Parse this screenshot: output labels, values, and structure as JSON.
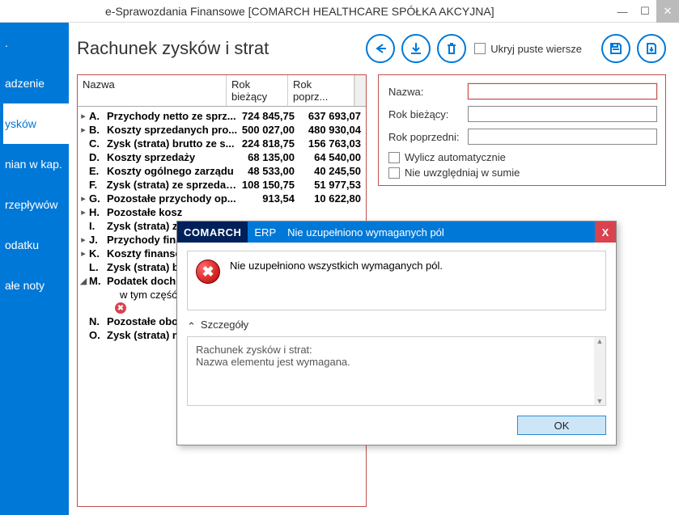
{
  "window": {
    "title": "e-Sprawozdania Finansowe  [COMARCH HEALTHCARE SPÓŁKA AKCYJNA]"
  },
  "sidebar": {
    "items": [
      {
        "label": "."
      },
      {
        "label": "adzenie"
      },
      {
        "label": "ysków"
      },
      {
        "label": "nian w kap."
      },
      {
        "label": "rzepływów"
      },
      {
        "label": "odatku"
      },
      {
        "label": "ałe noty"
      }
    ],
    "active_index": 2
  },
  "page": {
    "title": "Rachunek zysków i strat",
    "hide_empty_label": "Ukryj puste wiersze"
  },
  "table": {
    "headers": {
      "name": "Nazwa",
      "curr": "Rok bieżący",
      "prev": "Rok poprz..."
    },
    "rows": [
      {
        "exp": "▸",
        "let": "A.",
        "txt": "Przychody netto ze sprz...",
        "c1": "724 845,75",
        "c2": "637 693,07",
        "b": true
      },
      {
        "exp": "▸",
        "let": "B.",
        "txt": "Koszty sprzedanych pro...",
        "c1": "500 027,00",
        "c2": "480 930,04",
        "b": true
      },
      {
        "exp": "",
        "let": "C.",
        "txt": "Zysk (strata) brutto ze s...",
        "c1": "224 818,75",
        "c2": "156 763,03",
        "b": true
      },
      {
        "exp": "",
        "let": "D.",
        "txt": "Koszty sprzedaży",
        "c1": "68 135,00",
        "c2": "64 540,00",
        "b": true
      },
      {
        "exp": "",
        "let": "E.",
        "txt": "Koszty ogólnego zarządu",
        "c1": "48 533,00",
        "c2": "40 245,50",
        "b": true
      },
      {
        "exp": "",
        "let": "F.",
        "txt": "Zysk (strata) ze sprzedaż...",
        "c1": "108 150,75",
        "c2": "51 977,53",
        "b": true
      },
      {
        "exp": "▸",
        "let": "G.",
        "txt": "Pozostałe przychody op...",
        "c1": "913,54",
        "c2": "10 622,80",
        "b": true
      },
      {
        "exp": "▸",
        "let": "H.",
        "txt": "Pozostałe kosz",
        "c1": "",
        "c2": "",
        "b": true
      },
      {
        "exp": "",
        "let": "I.",
        "txt": "Zysk (strata) z",
        "c1": "",
        "c2": "",
        "b": true
      },
      {
        "exp": "▸",
        "let": "J.",
        "txt": "Przychody fina",
        "c1": "",
        "c2": "",
        "b": true
      },
      {
        "exp": "▸",
        "let": "K.",
        "txt": "Koszty finanso",
        "c1": "",
        "c2": "",
        "b": true
      },
      {
        "exp": "",
        "let": "L.",
        "txt": "Zysk (strata) b",
        "c1": "",
        "c2": "",
        "b": true
      },
      {
        "exp": "◢",
        "let": "M.",
        "txt": "Podatek doch",
        "c1": "",
        "c2": "",
        "b": true
      },
      {
        "exp": "",
        "let": "",
        "txt": "w tym część od",
        "c1": "",
        "c2": "",
        "b": false,
        "indent": true
      },
      {
        "exp": "",
        "let": "",
        "txt": "__ERROR__",
        "c1": "",
        "c2": "",
        "b": false,
        "indent": true
      },
      {
        "exp": "",
        "let": "N.",
        "txt": "Pozostałe obo",
        "c1": "",
        "c2": "",
        "b": true
      },
      {
        "exp": "",
        "let": "O.",
        "txt": "Zysk (strata) n",
        "c1": "",
        "c2": "",
        "b": true
      }
    ]
  },
  "form": {
    "name_label": "Nazwa:",
    "curr_label": "Rok bieżący:",
    "prev_label": "Rok poprzedni:",
    "auto_label": "Wylicz automatycznie",
    "exclude_label": "Nie uwzględniaj w sumie"
  },
  "dialog": {
    "brand1": "COMARCH",
    "brand2": "ERP",
    "title": "Nie uzupełniono wymaganych pól",
    "close": "X",
    "message": "Nie uzupełniono wszystkich wymaganych pól.",
    "details_label": "Szczegóły",
    "details_line1": "Rachunek zysków i strat:",
    "details_line2": "Nazwa elementu jest wymagana.",
    "ok": "OK"
  }
}
